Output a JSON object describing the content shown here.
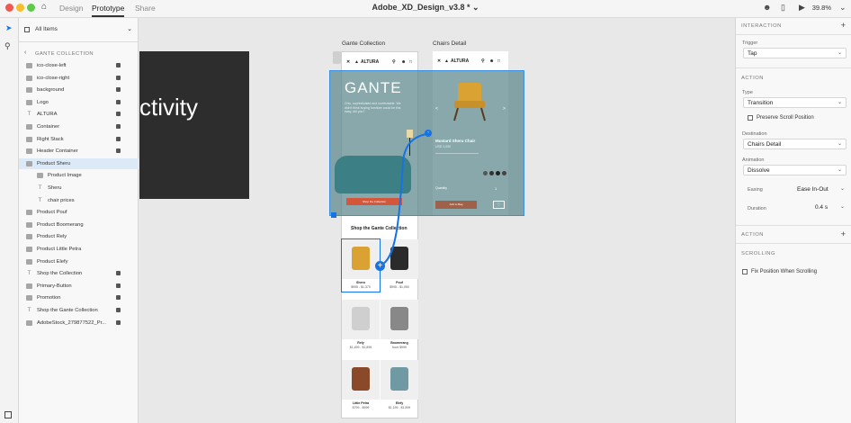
{
  "window": {
    "title": "Adobe_XD_Design_v3.8 *",
    "zoom": "39.8%"
  },
  "nav": {
    "design": "Design",
    "prototype": "Prototype",
    "share": "Share"
  },
  "layers": {
    "filter_label": "All Items",
    "section_title": "GANTE COLLECTION",
    "items": [
      {
        "label": "ico-close-left",
        "kind": "group",
        "lock": true
      },
      {
        "label": "ico-close-right",
        "kind": "group",
        "lock": true
      },
      {
        "label": "background",
        "kind": "group",
        "lock": true
      },
      {
        "label": "Logo",
        "kind": "group",
        "lock": true
      },
      {
        "label": "ALTURA",
        "kind": "text",
        "lock": true
      },
      {
        "label": "Container",
        "kind": "group",
        "lock": true
      },
      {
        "label": "Right Stack",
        "kind": "group",
        "lock": true
      },
      {
        "label": "Header Container",
        "kind": "group",
        "lock": true
      },
      {
        "label": "Product Sheru",
        "kind": "group",
        "lock": false
      },
      {
        "label": "Product Image",
        "kind": "group",
        "lock": false
      },
      {
        "label": "Sheru",
        "kind": "text",
        "lock": false
      },
      {
        "label": "chair prices",
        "kind": "text",
        "lock": false
      },
      {
        "label": "Product Pouf",
        "kind": "group",
        "lock": false
      },
      {
        "label": "Product Boomerang",
        "kind": "group",
        "lock": false
      },
      {
        "label": "Product Rely",
        "kind": "group",
        "lock": false
      },
      {
        "label": "Product Little Petra",
        "kind": "group",
        "lock": false
      },
      {
        "label": "Product Elefy",
        "kind": "group",
        "lock": false
      },
      {
        "label": "Shop the Collection",
        "kind": "text",
        "lock": true
      },
      {
        "label": "Primary-Button",
        "kind": "group",
        "lock": true
      },
      {
        "label": "Promotion",
        "kind": "group",
        "lock": true
      },
      {
        "label": "Shop the Gante Collection",
        "kind": "text",
        "lock": true
      },
      {
        "label": "AdobeStock_279877522_Pr...",
        "kind": "group",
        "lock": true
      }
    ]
  },
  "canvas": {
    "art_text": "ctivity",
    "artboard1_label": "Gante Collection",
    "artboard2_label": "Chairs Detail",
    "brand": "ALTURA",
    "hero_title": "GANTE",
    "hero_sub": "Chic, sophisticated and comfortable. We didn't think buying furniture could be this easy, did you?",
    "hero_button": "Shop the Collection",
    "detail_product": "Mustard Sheru Chair",
    "detail_price": "USD 1,000",
    "detail_quantity_label": "Quantity",
    "detail_quantity": "1",
    "detail_button": "Add to Bag",
    "shop_heading": "Shop the Gante Collection",
    "products": [
      {
        "name": "Sheru",
        "price": "$995 - $1,370"
      },
      {
        "name": "Pouf",
        "price": "$995 - $1,050"
      },
      {
        "name": "Rely",
        "price": "$1,499 - $1,899"
      },
      {
        "name": "Boomerang",
        "price": "from $999"
      },
      {
        "name": "Little Petra",
        "price": "$799 - $999"
      },
      {
        "name": "Elefy",
        "price": "$1,199 - $1,599"
      }
    ]
  },
  "inspector": {
    "interaction_title": "INTERACTION",
    "trigger_label": "Trigger",
    "trigger_value": "Tap",
    "action_title": "ACTION",
    "type_label": "Type",
    "type_value": "Transition",
    "preserve_scroll": "Preserve Scroll Position",
    "destination_label": "Destination",
    "destination_value": "Chairs Detail",
    "animation_label": "Animation",
    "animation_value": "Dissolve",
    "easing_label": "Easing",
    "easing_value": "Ease In-Out",
    "duration_label": "Duration",
    "duration_value": "0.4 s",
    "action2_title": "ACTION",
    "scrolling_title": "SCROLLING",
    "fix_position": "Fix Position When Scrolling"
  },
  "colors": {
    "accent": "#1473e6",
    "hero_teal": "#5a868c",
    "button_orange": "#d4573c",
    "mustard": "#d9a233"
  }
}
